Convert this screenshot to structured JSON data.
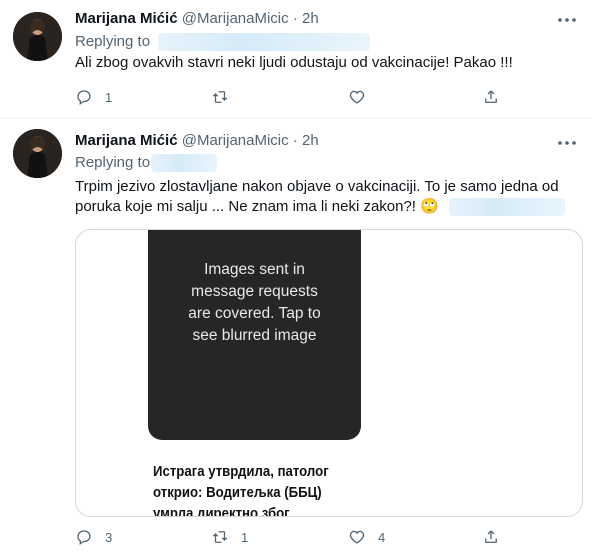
{
  "colors": {
    "text": "#0f1419",
    "secondary": "#536471",
    "border": "#cfd9de",
    "dark_panel": "#262626"
  },
  "tweets": [
    {
      "name": "Marijana Mićić",
      "handle": "@MarijanaMicic",
      "dot": "·",
      "time": "2h",
      "replying_label": "Replying to",
      "text": "Ali zbog ovakvih stavri neki ljudi odustaju od vakcinacije! Pakao !!!",
      "actions": {
        "reply_count": "1",
        "retweet_count": "",
        "like_count": ""
      }
    },
    {
      "name": "Marijana Mićić",
      "handle": "@MarijanaMicic",
      "dot": "·",
      "time": "2h",
      "replying_label": "Replying to",
      "text_line1": "Trpim jezivo zlostavljane nakon objave o vakcinaciji. To je samo jedna od",
      "text_line2": "poruka koje mi salju  ... Ne znam ima li neki zakon?!",
      "emoji": "🙄",
      "media": {
        "covered_message": "Images sent in message requests are covered. Tap to see blurred image",
        "covered_lines": [
          "Images sent in",
          "message requests",
          "are covered. Tap to",
          "see blurred image"
        ],
        "headline_lines": [
          "Истрага утврдила, патолог",
          "открио: Водитељка (ББЦ)",
          "умрла директно због"
        ]
      },
      "actions": {
        "reply_count": "3",
        "retweet_count": "1",
        "like_count": "4"
      }
    }
  ],
  "icons": [
    "more-icon",
    "reply-icon",
    "retweet-icon",
    "like-icon",
    "share-icon"
  ]
}
